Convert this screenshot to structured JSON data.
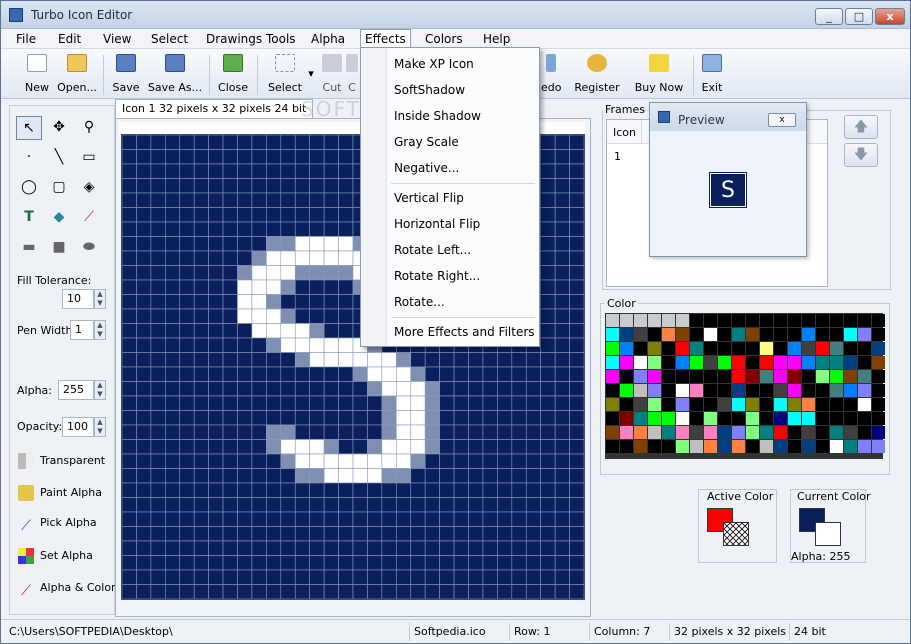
{
  "window": {
    "title": "Turbo Icon Editor",
    "min": "_",
    "max": "□",
    "close": "x"
  },
  "menubar": {
    "items": [
      "File",
      "Edit",
      "View",
      "Select",
      "Drawings Tools",
      "Alpha",
      "Effects",
      "Colors",
      "Help"
    ],
    "active": "Effects"
  },
  "toolbar": {
    "new": "New",
    "open": "Open...",
    "save": "Save",
    "save_as": "Save As...",
    "close": "Close",
    "select": "Select",
    "cut": "Cut",
    "copy_partial": "C",
    "redo_partial": "edo",
    "register": "Register",
    "buy_now": "Buy Now",
    "exit": "Exit"
  },
  "effects_menu": {
    "items": [
      "Make XP Icon",
      "SoftShadow",
      "Inside Shadow",
      "Gray Scale",
      "Negative...",
      "Vertical Flip",
      "Horizontal Flip",
      "Rotate Left...",
      "Rotate Right...",
      "Rotate...",
      "More Effects and Filters"
    ]
  },
  "left_panel": {
    "fill_tolerance_label": "Fill Tolerance:",
    "fill_tolerance": "10",
    "pen_width_label": "Pen Width:",
    "pen_width": "1",
    "alpha_label": "Alpha:",
    "alpha": "255",
    "opacity_label": "Opacity:",
    "opacity": "100",
    "transparent": "Transparent",
    "paint_alpha": "Paint Alpha",
    "pick_alpha": "Pick Alpha",
    "set_alpha": "Set Alpha",
    "alpha_color": "Alpha & Color"
  },
  "editor": {
    "tab": "Icon 1 32 pixels x 32 pixels 24 bit"
  },
  "frames": {
    "label": "Frames",
    "col_header": "Icon",
    "row1": "1"
  },
  "preview": {
    "title": "Preview",
    "glyph": "S",
    "close": "x"
  },
  "color": {
    "label": "Color",
    "active_label": "Active Color",
    "current_label": "Current Color",
    "alpha_text": "Alpha: 255",
    "active_hex": "#ff0000",
    "current_hex": "#0a1f5c"
  },
  "status": {
    "path": "C:\\Users\\SOFTPEDIA\\Desktop\\",
    "file": "Softpedia.ico",
    "row": "Row: 1",
    "column": "Column: 7",
    "size": "32 pixels x 32 pixels",
    "bits": "24 bit"
  },
  "watermark": "SOFTPEDIA"
}
